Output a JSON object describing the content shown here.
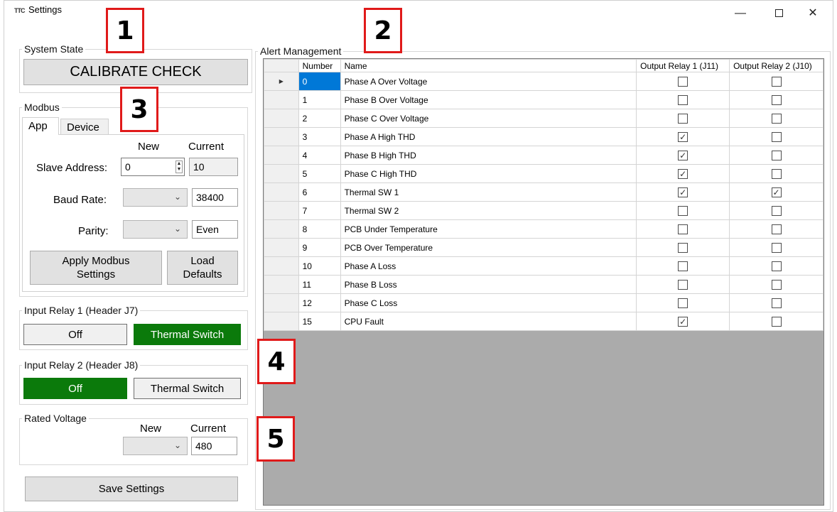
{
  "window": {
    "title": "Settings",
    "icon": "app-logo-icon",
    "controls": {
      "minimize": "—",
      "close": "✕"
    }
  },
  "system_state": {
    "legend": "System State",
    "button_label": "CALIBRATE CHECK"
  },
  "modbus": {
    "legend": "Modbus",
    "tabs": [
      {
        "label": "App",
        "active": true
      },
      {
        "label": "Device",
        "active": false
      }
    ],
    "col_new": "New",
    "col_current": "Current",
    "slave_address": {
      "label": "Slave Address:",
      "new_value": "0",
      "current_value": "10"
    },
    "baud_rate": {
      "label": "Baud Rate:",
      "new_value": "",
      "current_value": "38400"
    },
    "parity": {
      "label": "Parity:",
      "new_value": "",
      "current_value": "Even"
    },
    "apply_label_1": "Apply Modbus",
    "apply_label_2": "Settings",
    "load_label_1": "Load",
    "load_label_2": "Defaults"
  },
  "input_relay_1": {
    "legend": "Input Relay 1 (Header J7)",
    "off_label": "Off",
    "thermal_label": "Thermal Switch",
    "selected": "Thermal Switch"
  },
  "input_relay_2": {
    "legend": "Input Relay 2 (Header J8)",
    "off_label": "Off",
    "thermal_label": "Thermal Switch",
    "selected": "Off"
  },
  "rated_voltage": {
    "legend": "Rated Voltage",
    "col_new": "New",
    "col_current": "Current",
    "new_value": "",
    "current_value": "480"
  },
  "save_settings_label": "Save Settings",
  "alert_management": {
    "legend": "Alert Management",
    "columns": [
      "Number",
      "Name",
      "Output Relay 1 (J11)",
      "Output Relay 2 (J10)"
    ],
    "rows": [
      {
        "number": "0",
        "name": "Phase A Over Voltage",
        "relay1": false,
        "relay2": false
      },
      {
        "number": "1",
        "name": "Phase B Over Voltage",
        "relay1": false,
        "relay2": false
      },
      {
        "number": "2",
        "name": "Phase C Over Voltage",
        "relay1": false,
        "relay2": false
      },
      {
        "number": "3",
        "name": "Phase A High THD",
        "relay1": true,
        "relay2": false
      },
      {
        "number": "4",
        "name": "Phase B High THD",
        "relay1": true,
        "relay2": false
      },
      {
        "number": "5",
        "name": "Phase C High THD",
        "relay1": true,
        "relay2": false
      },
      {
        "number": "6",
        "name": "Thermal SW 1",
        "relay1": true,
        "relay2": true
      },
      {
        "number": "7",
        "name": "Thermal SW 2",
        "relay1": false,
        "relay2": false
      },
      {
        "number": "8",
        "name": "PCB Under Temperature",
        "relay1": false,
        "relay2": false
      },
      {
        "number": "9",
        "name": "PCB Over Temperature",
        "relay1": false,
        "relay2": false
      },
      {
        "number": "10",
        "name": "Phase A Loss",
        "relay1": false,
        "relay2": false
      },
      {
        "number": "11",
        "name": "Phase B Loss",
        "relay1": false,
        "relay2": false
      },
      {
        "number": "12",
        "name": "Phase C Loss",
        "relay1": false,
        "relay2": false
      },
      {
        "number": "15",
        "name": "CPU Fault",
        "relay1": true,
        "relay2": false
      }
    ]
  },
  "annotations": [
    "1",
    "2",
    "3",
    "4",
    "5"
  ],
  "colors": {
    "accent_green": "#0b7a0b",
    "selection_blue": "#0078d7",
    "annotation_red": "#e01a1a"
  }
}
